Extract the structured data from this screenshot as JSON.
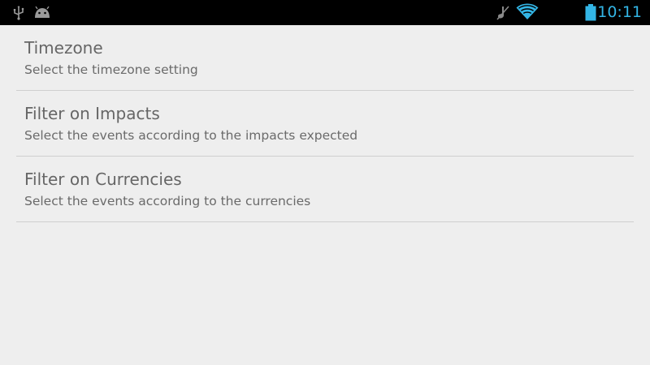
{
  "status_bar": {
    "left_icons": [
      "usb-icon",
      "android-debug-icon"
    ],
    "right_icons": [
      "mute-icon",
      "wifi-icon",
      "battery-icon"
    ],
    "time": "10:11",
    "accent_color": "#33b5e5"
  },
  "settings": {
    "items": [
      {
        "title": "Timezone",
        "summary": "Select the timezone setting"
      },
      {
        "title": "Filter on Impacts",
        "summary": "Select the events according to the impacts expected"
      },
      {
        "title": "Filter on Currencies",
        "summary": "Select the events according to the currencies"
      }
    ]
  }
}
